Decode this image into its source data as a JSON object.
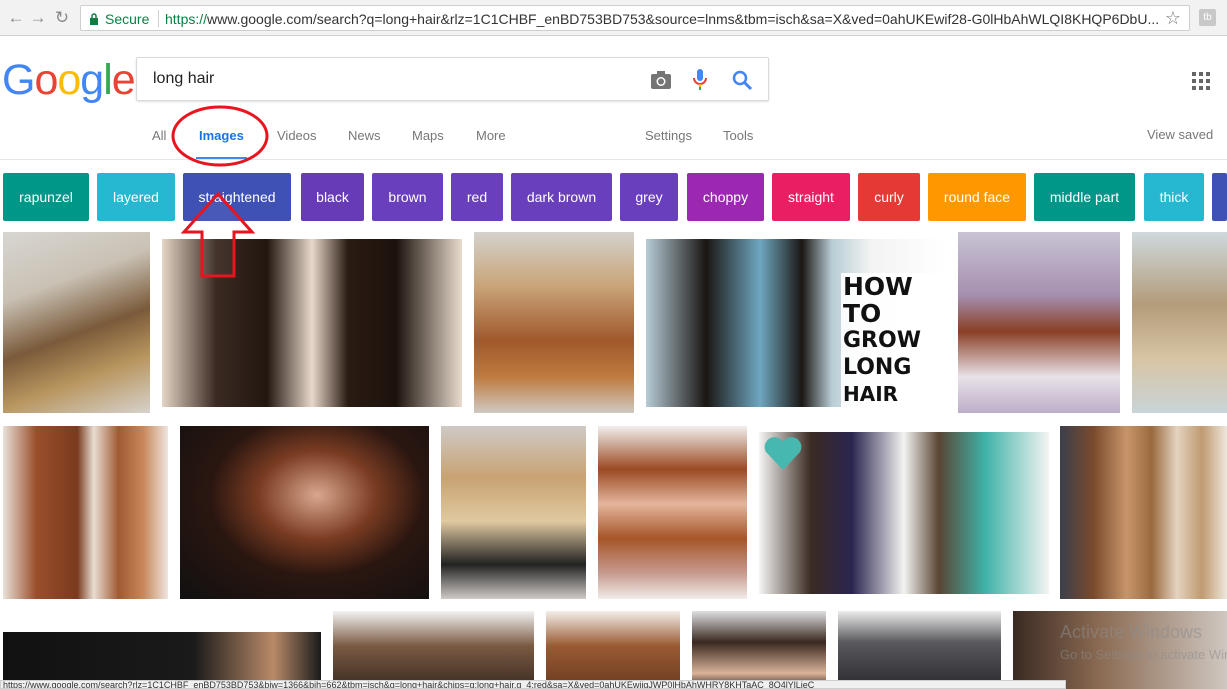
{
  "browser": {
    "secure_label": "Secure",
    "url_scheme": "https://",
    "url_rest": "www.google.com/search?q=long+hair&rlz=1C1CHBF_enBD753BD753&source=lnms&tbm=isch&sa=X&ved=0ahUKEwif28-G0lHbAhWLQI8KHQP6DbU...",
    "extension_label": "tb",
    "status_url": "https://www.google.com/search?rlz=1C1CHBF_enBD753BD753&biw=1366&bih=662&tbm=isch&q=long+hair&chips=q:long+hair,g_4:red&sa=X&ved=0ahUKEwjjqJWP0lHbAhWHRY8KHTaAC_8Q4lYlLjeC"
  },
  "logo": {
    "g1": "G",
    "o1": "o",
    "o2": "o",
    "g2": "g",
    "l": "l",
    "e": "e"
  },
  "search": {
    "query": "long hair"
  },
  "tabs": {
    "all": "All",
    "images": "Images",
    "videos": "Videos",
    "news": "News",
    "maps": "Maps",
    "more": "More",
    "settings": "Settings",
    "tools": "Tools",
    "view_saved": "View saved"
  },
  "chips": [
    {
      "label": "rapunzel",
      "color": "#009688"
    },
    {
      "label": "layered",
      "color": "#26b8d0"
    },
    {
      "label": "straightened",
      "color": "#3f51b5"
    },
    {
      "label": "black",
      "color": "#673ab7"
    },
    {
      "label": "brown",
      "color": "#6a3fbd"
    },
    {
      "label": "red",
      "color": "#6a3fbd"
    },
    {
      "label": "dark brown",
      "color": "#6a3fbd"
    },
    {
      "label": "grey",
      "color": "#6a3fbd"
    },
    {
      "label": "choppy",
      "color": "#9c27b0"
    },
    {
      "label": "straight",
      "color": "#e91e63"
    },
    {
      "label": "curly",
      "color": "#e53935"
    },
    {
      "label": "round face",
      "color": "#ff9800"
    },
    {
      "label": "middle part",
      "color": "#009688"
    },
    {
      "label": "thick",
      "color": "#26b8d0"
    }
  ],
  "overlay_text": {
    "line1": "HOW TO",
    "line2": "GROW LONG",
    "line3": "HAIR FAST!"
  },
  "watermark": {
    "title": "Activate Windows",
    "sub": "Go to Settings to activate Windows."
  }
}
